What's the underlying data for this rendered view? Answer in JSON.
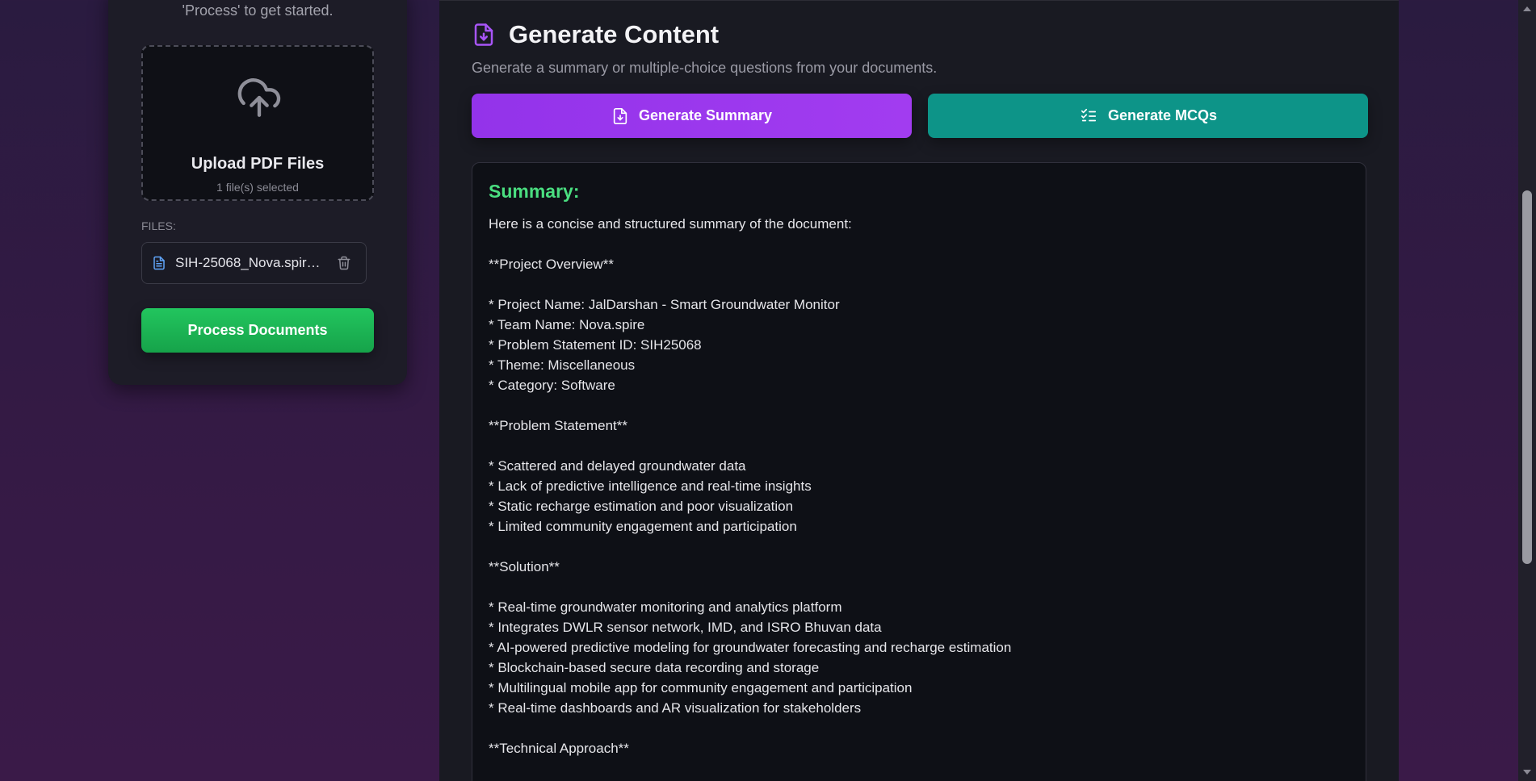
{
  "sidebar": {
    "hint_text": "'Process' to get started.",
    "upload": {
      "title": "Upload PDF Files",
      "status": "1 file(s) selected"
    },
    "files_label": "FILES:",
    "files": [
      {
        "name": "SIH-25068_Nova.spire..."
      }
    ],
    "process_label": "Process Documents"
  },
  "main": {
    "title": "Generate Content",
    "subtitle": "Generate a summary or multiple-choice questions from your documents.",
    "summary_button": "Generate Summary",
    "mcq_button": "Generate MCQs",
    "summary": {
      "heading": "Summary:",
      "lines": [
        "Here is a concise and structured summary of the document:",
        "",
        "**Project Overview**",
        "",
        "* Project Name: JalDarshan - Smart Groundwater Monitor",
        "* Team Name: Nova.spire",
        "* Problem Statement ID: SIH25068",
        "* Theme: Miscellaneous",
        "* Category: Software",
        "",
        "**Problem Statement**",
        "",
        "* Scattered and delayed groundwater data",
        "* Lack of predictive intelligence and real-time insights",
        "* Static recharge estimation and poor visualization",
        "* Limited community engagement and participation",
        "",
        "**Solution**",
        "",
        "* Real-time groundwater monitoring and analytics platform",
        "* Integrates DWLR sensor network, IMD, and ISRO Bhuvan data",
        "* AI-powered predictive modeling for groundwater forecasting and recharge estimation",
        "* Blockchain-based secure data recording and storage",
        "* Multilingual mobile app for community engagement and participation",
        "* Real-time dashboards and AR visualization for stakeholders",
        "",
        "**Technical Approach**"
      ]
    }
  },
  "colors": {
    "summary_button": "#9333ea",
    "mcq_button": "#0d9488",
    "process_button": "#22c55e",
    "summary_heading": "#4ade80"
  },
  "icons": {
    "upload": "cloud-upload-icon",
    "file": "file-text-icon",
    "delete": "trash-icon",
    "header": "file-download-icon",
    "summary": "file-download-icon",
    "mcq": "list-checks-icon"
  }
}
